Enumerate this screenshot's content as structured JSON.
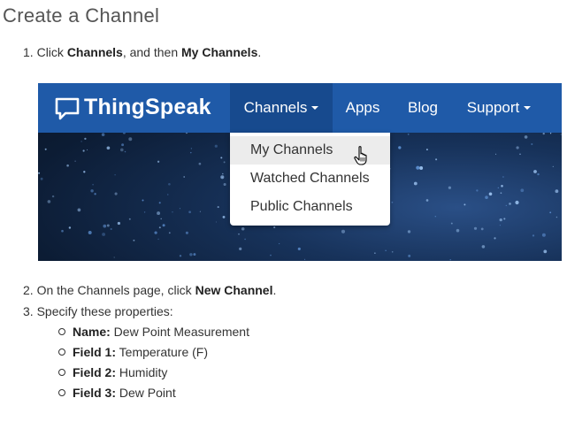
{
  "page": {
    "title": "Create a Channel",
    "step1": {
      "number": "1.",
      "prefix": "Click ",
      "bold1": "Channels",
      "middle": ", and then ",
      "bold2": "My Channels",
      "suffix": "."
    },
    "step2": {
      "number": "2.",
      "prefix": "On the Channels page, click ",
      "bold": "New Channel",
      "suffix": "."
    },
    "step3": {
      "number": "3.",
      "text": "Specify these properties:"
    },
    "properties": [
      {
        "label": "Name:",
        "value": " Dew Point Measurement"
      },
      {
        "label": "Field 1:",
        "value": " Temperature (F)"
      },
      {
        "label": "Field 2:",
        "value": " Humidity"
      },
      {
        "label": "Field 3:",
        "value": " Dew Point"
      }
    ]
  },
  "screenshot": {
    "brand": "ThingSpeak",
    "nav": {
      "channels": "Channels",
      "apps": "Apps",
      "blog": "Blog",
      "support": "Support"
    },
    "dropdown": [
      "My Channels",
      "Watched Channels",
      "Public Channels"
    ],
    "colors": {
      "navbar": "#1f5aa8",
      "navbar_active": "#174a8e",
      "hover": "#ececec"
    }
  }
}
